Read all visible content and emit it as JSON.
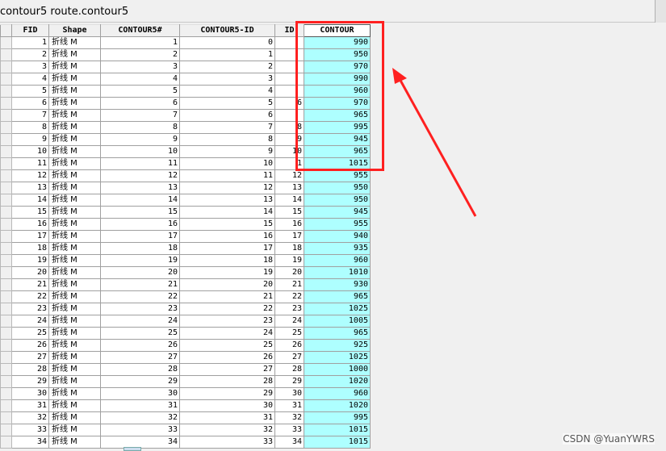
{
  "window": {
    "title": "contour5 route.contour5"
  },
  "table": {
    "columns": [
      "FID",
      "Shape",
      "CONTOUR5#",
      "CONTOUR5-ID",
      "ID",
      "CONTOUR"
    ],
    "rows": [
      [
        "1",
        "折线 M",
        "1",
        "0",
        "",
        "990"
      ],
      [
        "2",
        "折线 M",
        "2",
        "1",
        "",
        "950"
      ],
      [
        "3",
        "折线 M",
        "3",
        "2",
        "",
        "970"
      ],
      [
        "4",
        "折线 M",
        "4",
        "3",
        "",
        "990"
      ],
      [
        "5",
        "折线 M",
        "5",
        "4",
        "",
        "960"
      ],
      [
        "6",
        "折线 M",
        "6",
        "5",
        "6",
        "970"
      ],
      [
        "7",
        "折线 M",
        "7",
        "6",
        "",
        "965"
      ],
      [
        "8",
        "折线 M",
        "8",
        "7",
        "8",
        "995"
      ],
      [
        "9",
        "折线 M",
        "9",
        "8",
        "9",
        "945"
      ],
      [
        "10",
        "折线 M",
        "10",
        "9",
        "10",
        "965"
      ],
      [
        "11",
        "折线 M",
        "11",
        "10",
        "1",
        "1015"
      ],
      [
        "12",
        "折线 M",
        "12",
        "11",
        "12",
        "955"
      ],
      [
        "13",
        "折线 M",
        "13",
        "12",
        "13",
        "950"
      ],
      [
        "14",
        "折线 M",
        "14",
        "13",
        "14",
        "950"
      ],
      [
        "15",
        "折线 M",
        "15",
        "14",
        "15",
        "945"
      ],
      [
        "16",
        "折线 M",
        "16",
        "15",
        "16",
        "955"
      ],
      [
        "17",
        "折线 M",
        "17",
        "16",
        "17",
        "940"
      ],
      [
        "18",
        "折线 M",
        "18",
        "17",
        "18",
        "935"
      ],
      [
        "19",
        "折线 M",
        "19",
        "18",
        "19",
        "960"
      ],
      [
        "20",
        "折线 M",
        "20",
        "19",
        "20",
        "1010"
      ],
      [
        "21",
        "折线 M",
        "21",
        "20",
        "21",
        "930"
      ],
      [
        "22",
        "折线 M",
        "22",
        "21",
        "22",
        "965"
      ],
      [
        "23",
        "折线 M",
        "23",
        "22",
        "23",
        "1025"
      ],
      [
        "24",
        "折线 M",
        "24",
        "23",
        "24",
        "1005"
      ],
      [
        "25",
        "折线 M",
        "25",
        "24",
        "25",
        "965"
      ],
      [
        "26",
        "折线 M",
        "26",
        "25",
        "26",
        "925"
      ],
      [
        "27",
        "折线 M",
        "27",
        "26",
        "27",
        "1025"
      ],
      [
        "28",
        "折线 M",
        "28",
        "27",
        "28",
        "1000"
      ],
      [
        "29",
        "折线 M",
        "29",
        "28",
        "29",
        "1020"
      ],
      [
        "30",
        "折线 M",
        "30",
        "29",
        "30",
        "960"
      ],
      [
        "31",
        "折线 M",
        "31",
        "30",
        "31",
        "1020"
      ],
      [
        "32",
        "折线 M",
        "32",
        "31",
        "32",
        "995"
      ],
      [
        "33",
        "折线 M",
        "33",
        "32",
        "33",
        "1015"
      ],
      [
        "34",
        "折线 M",
        "34",
        "33",
        "34",
        "1015"
      ]
    ]
  },
  "annotation": {
    "highlight_color": "#ff2020",
    "contour_cell_color": "#aeffff"
  },
  "watermark": "CSDN @YuanYWRS"
}
